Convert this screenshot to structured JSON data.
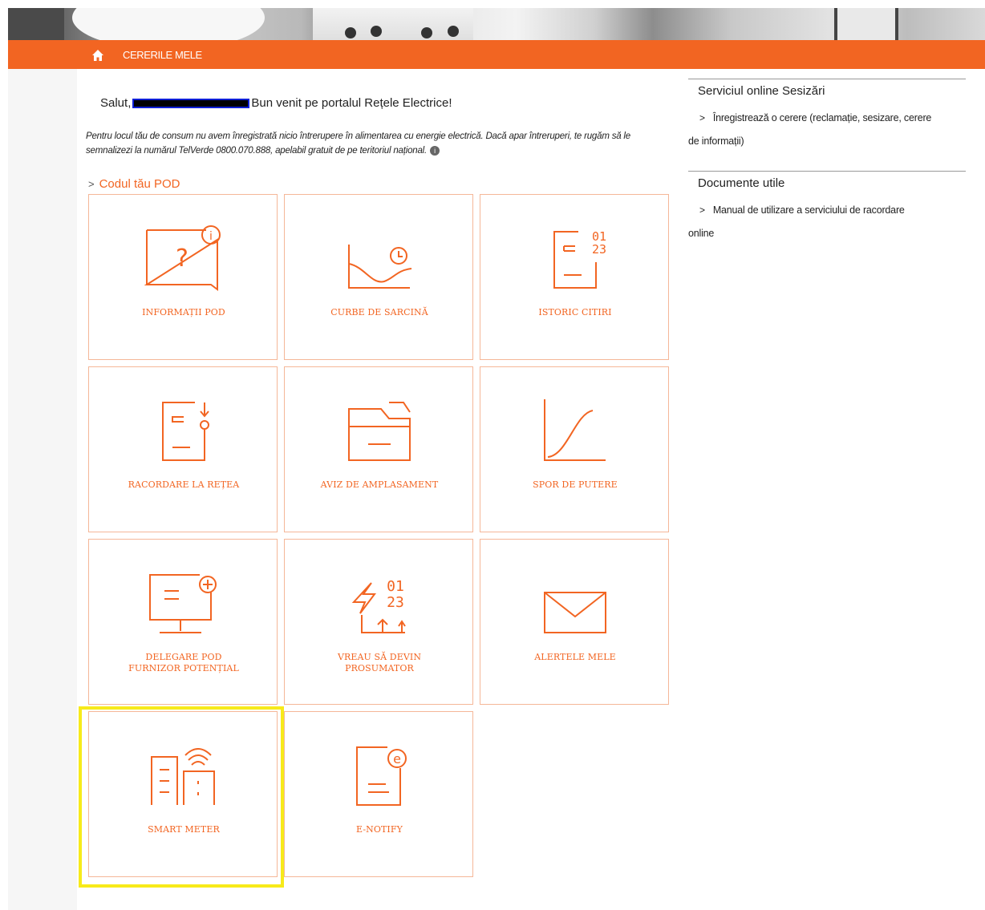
{
  "nav": {
    "label": "CERERILE MELE"
  },
  "greeting": {
    "prefix": "Salut,",
    "suffix": "Bun venit pe portalul Rețele Electrice!"
  },
  "notice": {
    "text": "Pentru locul tău de consum nu avem înregistrată nicio întrerupere în alimentarea cu energie electrică. Dacă apar întreruperi, te rugăm să le semnalizezi la numărul TelVerde 0800.070.888, apelabil gratuit de pe teritoriul național.",
    "info_glyph": "i"
  },
  "pod_link": {
    "label": "Codul tău POD"
  },
  "tiles": [
    {
      "lines": [
        "INFORMAȚII POD"
      ],
      "icon": "info-pod-icon"
    },
    {
      "lines": [
        "CURBE DE SARCINĂ"
      ],
      "icon": "load-curve-icon"
    },
    {
      "lines": [
        "ISTORIC CITIRI"
      ],
      "icon": "reading-history-icon"
    },
    {
      "lines": [
        "RACORDARE LA REȚEA"
      ],
      "icon": "grid-connection-icon"
    },
    {
      "lines": [
        "AVIZ DE AMPLASAMENT"
      ],
      "icon": "folder-icon"
    },
    {
      "lines": [
        "SPOR DE PUTERE"
      ],
      "icon": "power-curve-icon"
    },
    {
      "lines": [
        "DELEGARE POD",
        "FURNIZOR POTENȚIAL"
      ],
      "icon": "monitor-plus-icon"
    },
    {
      "lines": [
        "VREAU SĂ DEVIN",
        "PROSUMATOR"
      ],
      "icon": "prosumer-icon"
    },
    {
      "lines": [
        "ALERTELE MELE"
      ],
      "icon": "envelope-icon"
    },
    {
      "lines": [
        "SMART METER"
      ],
      "icon": "smart-meter-icon"
    },
    {
      "lines": [
        "E-NOTIFY"
      ],
      "icon": "e-notify-icon"
    }
  ],
  "icon_text": {
    "digits_a": "01",
    "digits_b": "23",
    "info_i": "i",
    "question": "?",
    "e_letter": "e"
  },
  "sidebar": {
    "sections": [
      {
        "title": "Serviciul online Sesizări",
        "link_line1": "Înregistrează o cerere (reclamație, sesizare, cerere",
        "link_line2": "de informații)"
      },
      {
        "title": "Documente utile",
        "link_line1": "Manual de utilizare a serviciului de racordare",
        "link_line2": "online"
      }
    ]
  },
  "colors": {
    "accent": "#f26522",
    "tile_border": "#f5b798",
    "highlight": "#f7ea1a"
  }
}
